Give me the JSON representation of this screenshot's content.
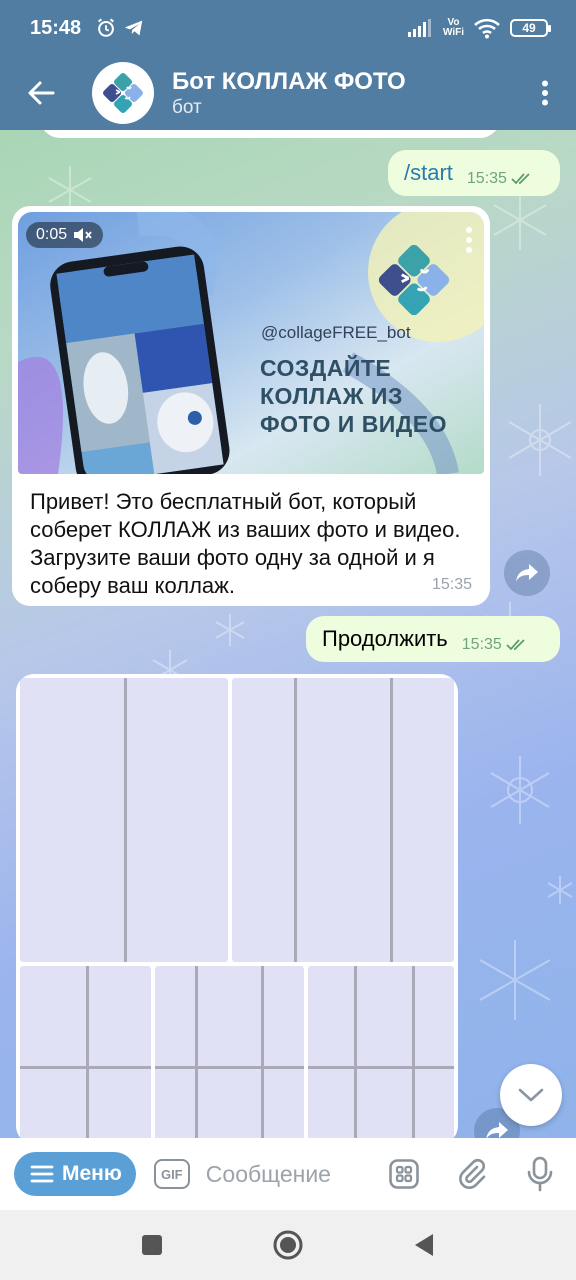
{
  "status_bar": {
    "time": "15:48",
    "vowifi_top": "Vo",
    "vowifi_bottom": "WiFi",
    "battery": "49"
  },
  "header": {
    "title": "Бот КОЛЛАЖ ФОТО",
    "subtitle": "бот"
  },
  "messages": {
    "start": {
      "text": "/start",
      "time": "15:35"
    },
    "bot_intro": {
      "media_duration": "0:05",
      "media_handle": "@collageFREE_bot",
      "media_headline_1": "Создайте",
      "media_headline_2": "коллаж из",
      "media_headline_3": "фото и видео",
      "text": "Привет! Это бесплатный бот, который соберет КОЛЛАЖ из ваших фото и видео. Загрузите ваши фото одну за одной и я соберу ваш коллаж.",
      "time": "15:35"
    },
    "continue": {
      "text": "Продолжить",
      "time": "15:35"
    }
  },
  "input_bar": {
    "menu_label": "Меню",
    "gif_label": "GIF",
    "placeholder": "Сообщение"
  },
  "colors": {
    "header": "#527da3",
    "outgoing_bubble": "#effddf",
    "menu_button": "#5a9fd6",
    "command_link": "#2a7ab0"
  }
}
